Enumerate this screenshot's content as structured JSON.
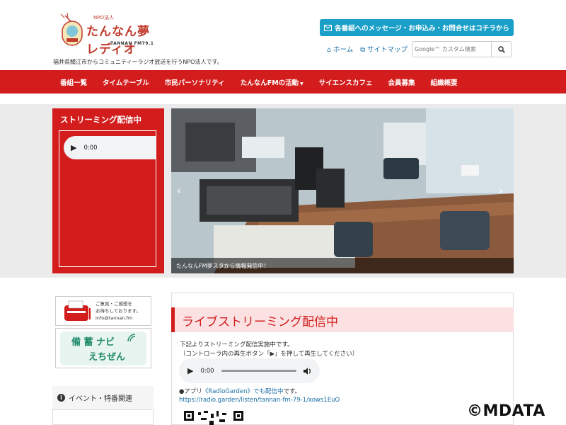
{
  "logo": {
    "small": "NPO法人",
    "main": "たんなん夢レディオ",
    "sub": "TANNAN FM79.1"
  },
  "tagline": "福井県鯖江市からコミュニティーラジオ放送を行うNPO法人です。",
  "header": {
    "contact_button": "各番組へのメッセージ・お申込み・お問合せはコチラから",
    "home_link": "ホーム",
    "sitemap_link": "サイトマップ",
    "search_placeholder": "Google™ カスタム検索"
  },
  "nav": {
    "items": [
      "番組一覧",
      "タイムテーブル",
      "市民パーソナリティ",
      "たんなんFMの活動",
      "サイエンスカフェ",
      "会員募集",
      "組織概要"
    ]
  },
  "streaming_box": {
    "title": "ストリーミング配信中",
    "time": "0:00"
  },
  "hero": {
    "caption": "たんなんFM夢スタから情報発信中！"
  },
  "sidebar": {
    "banner1_lines": [
      "ご意見・ご感想を",
      "お待ちしております。",
      "info@tannan.fm"
    ],
    "banner2_line1": "備 蓄 ナビ",
    "banner2_line2": "えちぜん",
    "event_title": "イベント・特番関連"
  },
  "main": {
    "heading": "ライブストリーミング配信中",
    "line1": "下記よりストリーミング配信実施中です。",
    "line2": "（コントローラ内の再生ボタン「▶」を押して再生してください）",
    "player_time": "0:00",
    "app_prefix": "●アプリ",
    "app_link": "《RadioGarden》でも配信中",
    "app_suffix": "です。",
    "url": "https://radio.garden/listen/tannan-fm-79-1/xows1EuO"
  },
  "watermark": "©MDATA",
  "colors": {
    "brand_red": "#d31d1d",
    "contact_blue": "#1aa0c8",
    "link_blue": "#1a6fa5"
  }
}
